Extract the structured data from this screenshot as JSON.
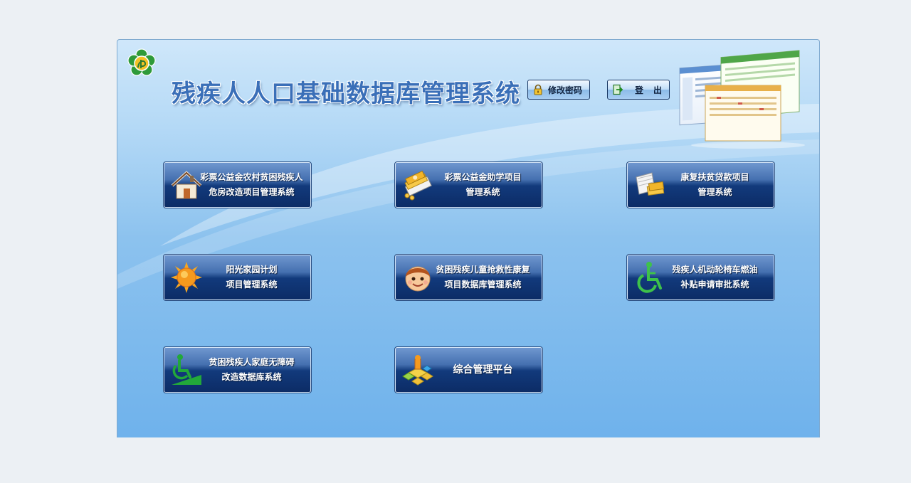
{
  "header": {
    "title": "残疾人人口基础数据库管理系统",
    "change_password_label": "修改密码",
    "logout_label": "登出"
  },
  "systems": [
    {
      "line1": "彩票公益金农村贫困残疾人",
      "line2": "危房改造项目管理系统",
      "icon": "house-icon"
    },
    {
      "line1": "彩票公益金助学项目",
      "line2": "管理系统",
      "icon": "money-stack-icon"
    },
    {
      "line1": "康复扶贫贷款项目",
      "line2": "管理系统",
      "icon": "cash-book-icon"
    },
    {
      "line1": "阳光家园计划",
      "line2": "项目管理系统",
      "icon": "sun-icon"
    },
    {
      "line1": "贫困残疾儿童抢救性康复",
      "line2": "项目数据库管理系统",
      "icon": "child-face-icon"
    },
    {
      "line1": "残疾人机动轮椅车燃油",
      "line2": "补贴申请审批系统",
      "icon": "wheelchair-icon"
    },
    {
      "line1": "贫困残疾人家庭无障碍",
      "line2": "改造数据库系统",
      "icon": "wheelchair-ramp-icon"
    },
    {
      "line1": "综合管理平台",
      "line2": "",
      "icon": "platform-cubes-icon"
    }
  ],
  "colors": {
    "page_bg": "#ecf0f4",
    "button_dark": "#0c2c66",
    "title_blue": "#3a6fb8"
  }
}
